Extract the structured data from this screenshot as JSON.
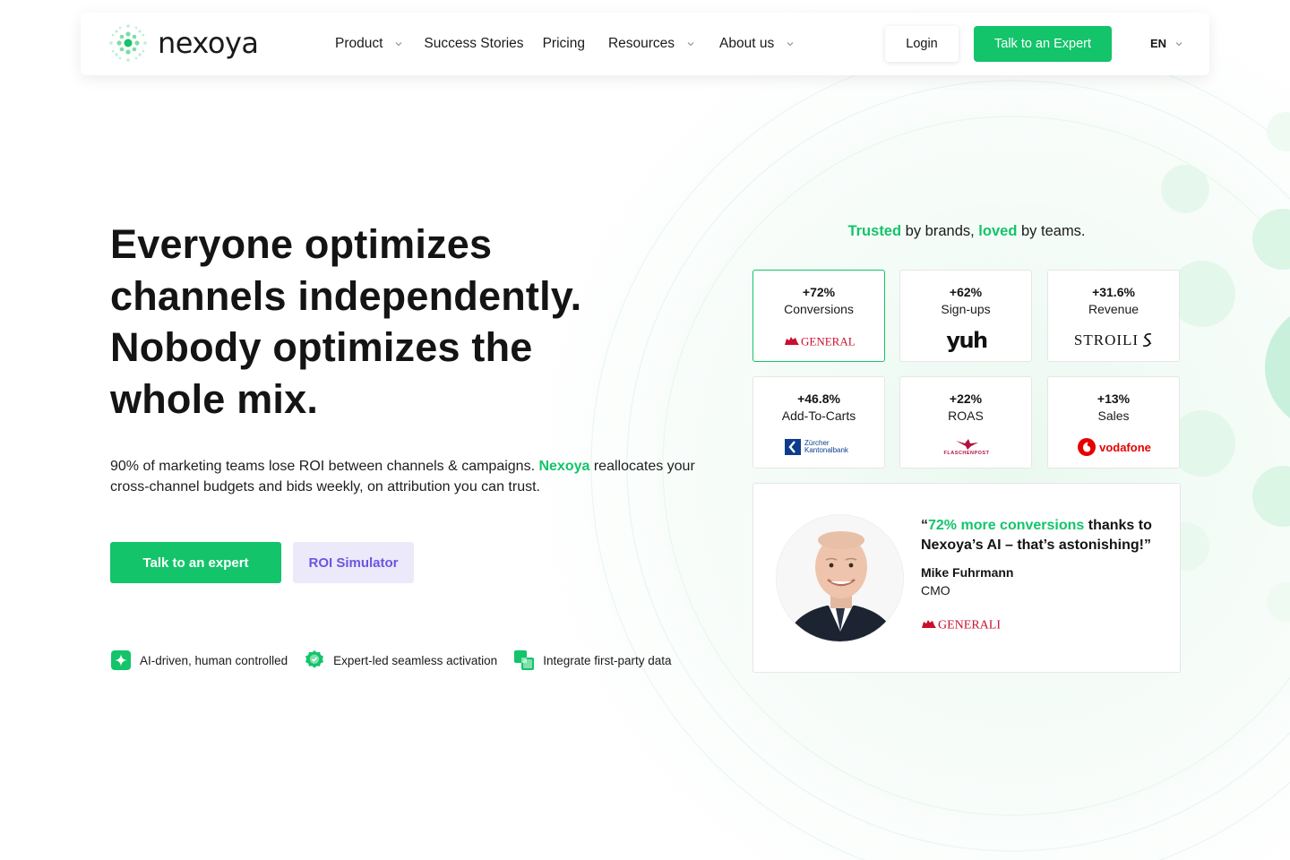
{
  "nav": {
    "logo_text": "nexoya",
    "menu": [
      {
        "label": "Product",
        "has_dropdown": true
      },
      {
        "label": "Success Stories",
        "has_dropdown": false
      },
      {
        "label": "Pricing",
        "has_dropdown": false
      },
      {
        "label": "Resources",
        "has_dropdown": true
      },
      {
        "label": "About us",
        "has_dropdown": true
      }
    ],
    "login_label": "Login",
    "expert_label": "Talk to an Expert",
    "language": "EN"
  },
  "hero": {
    "title_lines": [
      "Everyone optimizes",
      "channels independently.",
      "Nobody optimizes the",
      "whole mix."
    ],
    "subtitle_before": "90% of marketing teams lose ROI between channels & campaigns. ",
    "subtitle_brand": "Nexoya",
    "subtitle_after": " reallocates your cross-channel budgets and bids weekly, on attribution you can trust.",
    "cta_primary": "Talk to an expert",
    "cta_secondary": "ROI Simulator",
    "features": [
      {
        "icon": "ai-sparkle-icon",
        "label": "AI-driven, human controlled"
      },
      {
        "icon": "verified-badge-icon",
        "label": "Expert-led seamless activation"
      },
      {
        "icon": "data-layers-icon",
        "label": "Integrate first-party data"
      }
    ]
  },
  "trust": {
    "word1": "Trusted",
    "mid1": " by brands, ",
    "word2": "loved",
    "mid2": " by teams.",
    "cards": [
      {
        "value": "+72%",
        "label": "Conversions",
        "logo": "generali-logo",
        "logo_text": "GENERALI",
        "active": true
      },
      {
        "value": "+62%",
        "label": "Sign-ups",
        "logo": "yuh-logo",
        "logo_text": "yuh",
        "active": false
      },
      {
        "value": "+31.6%",
        "label": "Revenue",
        "logo": "stroili-logo",
        "logo_text": "STROILI",
        "active": false
      },
      {
        "value": "+46.8%",
        "label": "Add-To-Carts",
        "logo": "zkb-logo",
        "logo_text": "Zürcher Kantonalbank",
        "active": false
      },
      {
        "value": "+22%",
        "label": "ROAS",
        "logo": "flaschenpost-logo",
        "logo_text": "FLASCHENPOST",
        "active": false
      },
      {
        "value": "+13%",
        "label": "Sales",
        "logo": "vodafone-logo",
        "logo_text": "vodafone",
        "active": false
      }
    ]
  },
  "testimonial": {
    "quote_open": "“",
    "quote_highlight": "72% more conversions",
    "quote_rest": " thanks to Nexoya’s AI – that’s astonishing!”",
    "name": "Mike Fuhrmann",
    "role": "CMO",
    "logo_text": "GENERALI"
  },
  "colors": {
    "accent": "#13c46a",
    "secondary_bg": "#ece9fb",
    "secondary_text": "#6a56e0",
    "generali_red": "#c8102e",
    "vodafone_red": "#e60000",
    "zkb_blue": "#0e3c8c"
  }
}
